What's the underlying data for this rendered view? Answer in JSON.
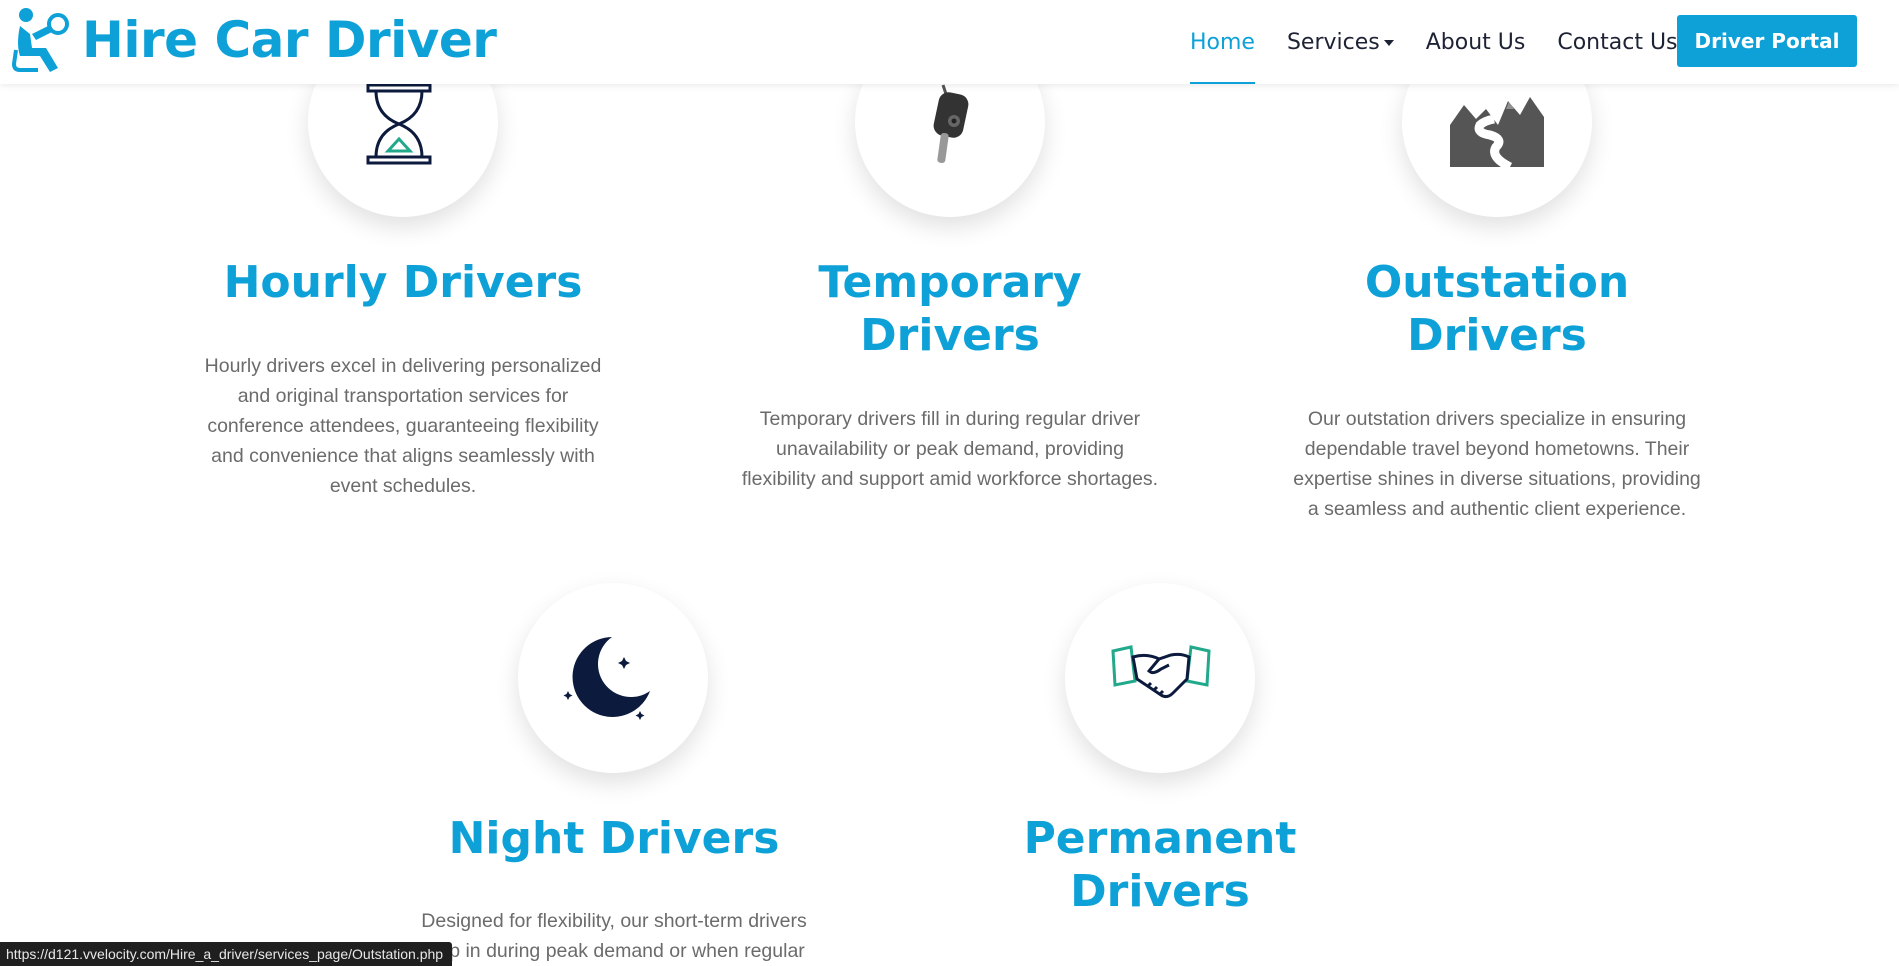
{
  "brand": {
    "name": "Hire Car Driver",
    "icon": "seated-driver-icon",
    "color": "#0ea1d8"
  },
  "nav": {
    "items": [
      {
        "label": "Home",
        "active": true
      },
      {
        "label": "Services",
        "dropdown": true
      },
      {
        "label": "About Us"
      },
      {
        "label": "Contact Us"
      }
    ],
    "portal_button": "Driver Portal"
  },
  "services": [
    {
      "title_lines": [
        "Hourly Drivers"
      ],
      "icon": "hourglass-icon",
      "desc_lines": [
        "Hourly drivers excel in delivering personalized",
        "and original transportation services for",
        "conference attendees, guaranteeing flexibility",
        "and convenience that aligns seamlessly with",
        "event schedules."
      ]
    },
    {
      "title_lines": [
        "Temporary",
        "Drivers"
      ],
      "icon": "car-key-icon",
      "desc_lines": [
        "Temporary drivers fill in during regular driver",
        "unavailability or peak demand, providing",
        "flexibility and support amid workforce shortages."
      ]
    },
    {
      "title_lines": [
        "Outstation",
        "Drivers"
      ],
      "icon": "mountain-road-icon",
      "desc_lines": [
        "Our outstation drivers specialize in ensuring",
        "dependable travel beyond hometowns. Their",
        "expertise shines in diverse situations, providing",
        "a seamless and authentic client experience."
      ]
    },
    {
      "title_lines": [
        "Night Drivers"
      ],
      "icon": "moon-icon",
      "desc_lines": [
        "Designed for flexibility, our short-term drivers",
        "step in during peak demand or when regular"
      ]
    },
    {
      "title_lines": [
        "Permanent",
        "Drivers"
      ],
      "icon": "handshake-icon",
      "desc_lines": []
    }
  ],
  "status_bar": {
    "url": "https://d121.vvelocity.com/Hire_a_driver/services_page/Outstation.php"
  },
  "colors": {
    "accent": "#0ea1d8",
    "text": "#1d2235",
    "muted": "#6b6b6b",
    "navy": "#0c1a3d",
    "teal": "#22a98c"
  }
}
